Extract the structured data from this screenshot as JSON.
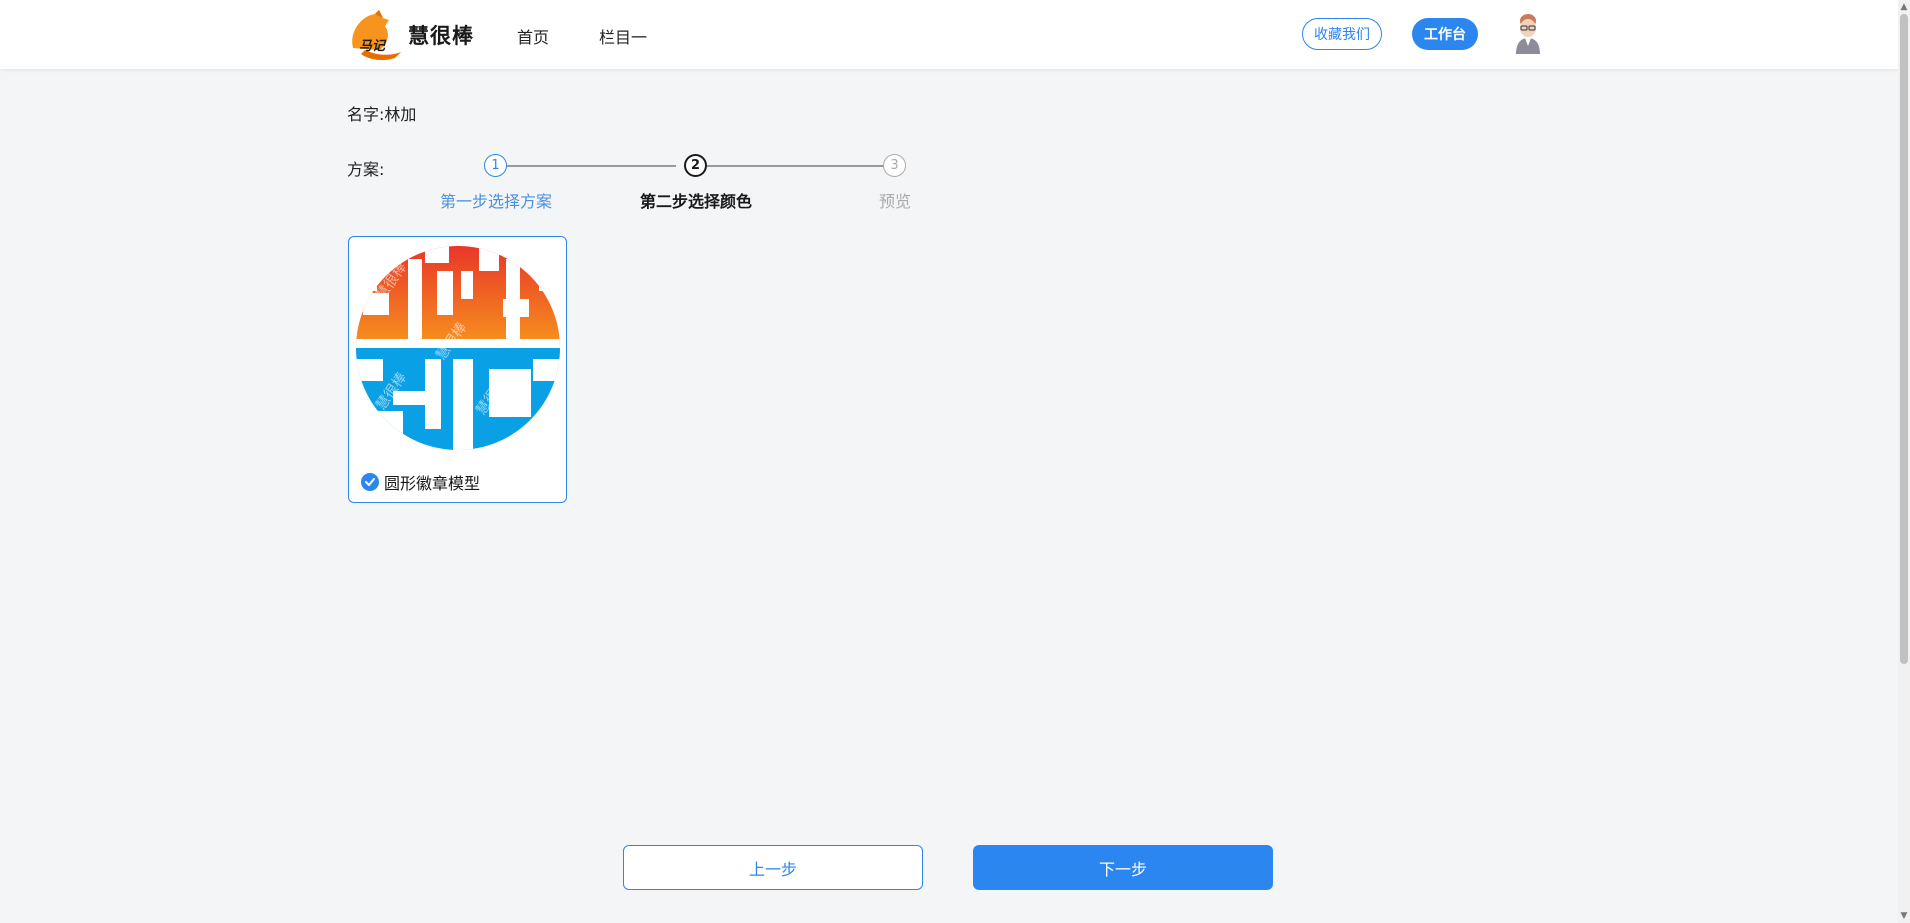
{
  "header": {
    "logo_text": "马记",
    "brand": "慧很棒",
    "nav": [
      {
        "label": "首页"
      },
      {
        "label": "栏目一"
      }
    ],
    "favorite_label": "收藏我们",
    "workbench_label": "工作台"
  },
  "form": {
    "name_label": "名字:",
    "name_value": "林加",
    "plan_label": "方案:"
  },
  "steps": [
    {
      "number": "1",
      "label": "第一步选择方案",
      "state": "done"
    },
    {
      "number": "2",
      "label": "第二步选择颜色",
      "state": "active"
    },
    {
      "number": "3",
      "label": "预览",
      "state": "pending"
    }
  ],
  "card": {
    "title": "圆形徽章模型",
    "selected": true,
    "watermark": "慧很棒",
    "top_color_from": "#e8312a",
    "top_color_to": "#f7941d",
    "bottom_color": "#0aa0e6"
  },
  "buttons": {
    "prev_label": "上一步",
    "next_label": "下一步"
  },
  "colors": {
    "accent": "#2b86f0"
  }
}
